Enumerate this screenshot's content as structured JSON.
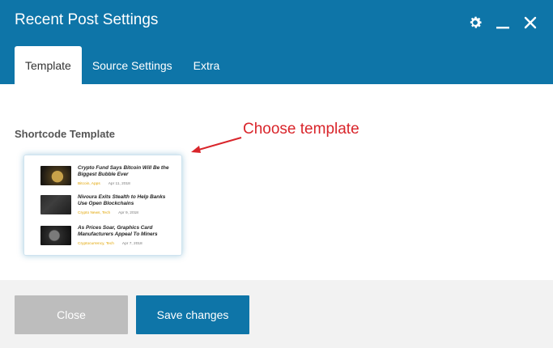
{
  "dialog": {
    "title": "Recent Post Settings",
    "header_icons": [
      "gear-icon",
      "minimize-icon",
      "close-icon"
    ]
  },
  "tabs": [
    {
      "label": "Template",
      "active": true
    },
    {
      "label": "Source Settings",
      "active": false
    },
    {
      "label": "Extra",
      "active": false
    }
  ],
  "content": {
    "section_label": "Shortcode Template",
    "annotation": "Choose template",
    "template_preview": {
      "posts": [
        {
          "title": "Crypto Fund Says Bitcoin Will Be the Biggest Bubble Ever",
          "category": "Bitcoin, Apps",
          "date": "Apr 11, 2018"
        },
        {
          "title": "Nivoura Exits Stealth to Help Banks Use Open Blockchains",
          "category": "Crypto News, Tech",
          "date": "Apr 9, 2018"
        },
        {
          "title": "As Prices Soar, Graphics Card Manufacturers Appeal To Miners",
          "category": "Cryptocurrency, Tech",
          "date": "Apr 7, 2018"
        }
      ]
    }
  },
  "footer": {
    "close_label": "Close",
    "save_label": "Save changes"
  },
  "colors": {
    "header": "#0e75a8",
    "annotation": "#d9252b",
    "close_button": "#bdbdbd",
    "save_button": "#0e75a8"
  }
}
